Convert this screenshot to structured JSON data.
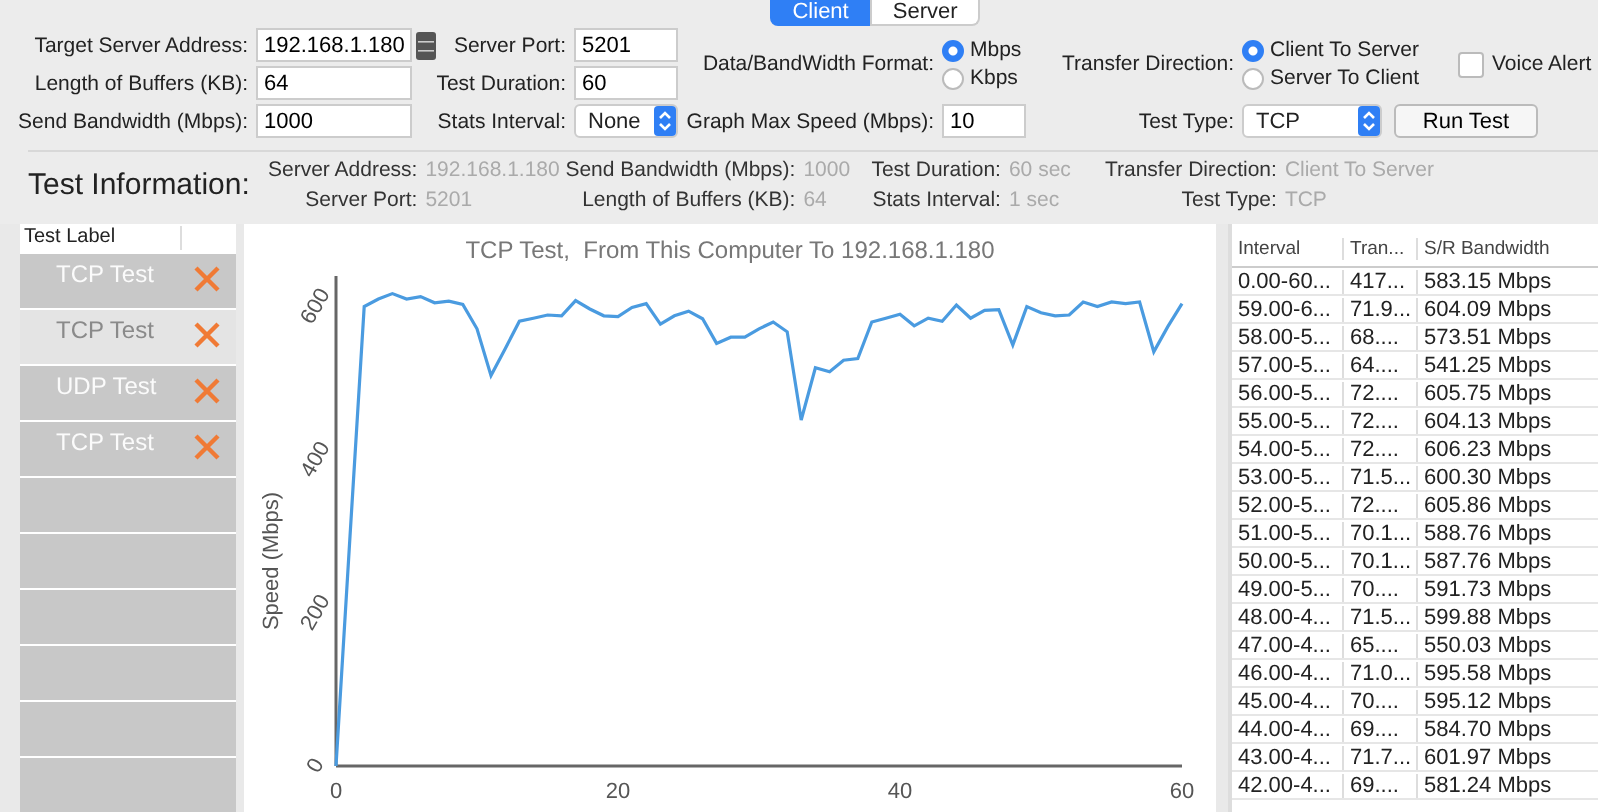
{
  "mode_tabs": [
    {
      "label": "Client",
      "selected": true
    },
    {
      "label": "Server",
      "selected": false
    }
  ],
  "form": {
    "target_server_address": {
      "label": "Target Server Address:",
      "value": "192.168.1.180"
    },
    "server_port": {
      "label": "Server Port:",
      "value": "5201"
    },
    "bandwidth_format": {
      "label": "Data/BandWidth Format:",
      "options": [
        {
          "label": "Mbps",
          "selected": true
        },
        {
          "label": "Kbps",
          "selected": false
        }
      ]
    },
    "transfer_direction": {
      "label": "Transfer Direction:",
      "options": [
        {
          "label": "Client To Server",
          "selected": true
        },
        {
          "label": "Server To Client",
          "selected": false
        }
      ]
    },
    "voice_alert": {
      "label": "Voice Alert",
      "checked": false
    },
    "length_of_buffers": {
      "label": "Length of Buffers (KB):",
      "value": "64"
    },
    "test_duration": {
      "label": "Test Duration:",
      "value": "60"
    },
    "send_bandwidth": {
      "label": "Send Bandwidth (Mbps):",
      "value": "1000"
    },
    "stats_interval": {
      "label": "Stats Interval:",
      "value": "None"
    },
    "graph_max_speed": {
      "label": "Graph Max Speed (Mbps):",
      "value": "10"
    },
    "test_type": {
      "label": "Test Type:",
      "value": "TCP"
    },
    "run_button": "Run Test"
  },
  "test_information": {
    "title": "Test Information:",
    "items": [
      {
        "label": "Server Address:",
        "value": "192.168.1.180"
      },
      {
        "label": "Send Bandwidth (Mbps):",
        "value": "1000"
      },
      {
        "label": "Test Duration:",
        "value": "60 sec"
      },
      {
        "label": "Transfer Direction:",
        "value": "Client To Server"
      },
      {
        "label": "Server Port:",
        "value": "5201"
      },
      {
        "label": "Length of Buffers (KB):",
        "value": "64"
      },
      {
        "label": "Stats Interval:",
        "value": "1 sec"
      },
      {
        "label": "Test Type:",
        "value": "TCP"
      }
    ]
  },
  "test_list": {
    "header": "Test Label",
    "items": [
      {
        "label": "TCP Test",
        "selected": false
      },
      {
        "label": "TCP Test",
        "selected": true
      },
      {
        "label": "UDP Test",
        "selected": false
      },
      {
        "label": "TCP Test",
        "selected": false
      }
    ]
  },
  "chart": {
    "chart_data": {
      "type": "line",
      "title": "TCP Test,  From This Computer To 192.168.1.180",
      "ylabel": "Speed (Mbps)",
      "x": [
        0,
        1,
        2,
        3,
        4,
        5,
        6,
        7,
        8,
        9,
        10,
        11,
        12,
        13,
        14,
        15,
        16,
        17,
        18,
        19,
        20,
        21,
        22,
        23,
        24,
        25,
        26,
        27,
        28,
        29,
        30,
        31,
        32,
        33,
        34,
        35,
        36,
        37,
        38,
        39,
        40,
        41,
        42,
        43,
        44,
        45,
        46,
        47,
        48,
        49,
        50,
        51,
        52,
        53,
        54,
        55,
        56,
        57,
        58,
        59,
        60
      ],
      "series": [
        {
          "color": "#4a9be0",
          "values": [
            0,
            300,
            600,
            610,
            617,
            610,
            613,
            605,
            607,
            603,
            571,
            510,
            545,
            581,
            585,
            589,
            588,
            608,
            597,
            588,
            587,
            599,
            604,
            577,
            588,
            594,
            584,
            552,
            560,
            560,
            571,
            580,
            567,
            452,
            520,
            515,
            530,
            532,
            580,
            585,
            590,
            575,
            585,
            581,
            602,
            585,
            595,
            596,
            550,
            600,
            592,
            588,
            589,
            606,
            600,
            606,
            604,
            606,
            541,
            574,
            604
          ]
        }
      ],
      "xlim": [
        0,
        60
      ],
      "ylim": [
        0,
        640
      ],
      "xticks": [
        0,
        20,
        40,
        60
      ],
      "yticks": [
        0,
        200,
        400,
        600
      ]
    }
  },
  "results_table": {
    "columns": [
      "Interval",
      "Tran...",
      "S/R Bandwidth"
    ],
    "rows": [
      [
        "0.00-60...",
        "417...",
        "583.15 Mbps"
      ],
      [
        "59.00-6...",
        "71.9...",
        "604.09 Mbps"
      ],
      [
        "58.00-5...",
        "68....",
        "573.51 Mbps"
      ],
      [
        "57.00-5...",
        "64....",
        "541.25 Mbps"
      ],
      [
        "56.00-5...",
        "72....",
        "605.75 Mbps"
      ],
      [
        "55.00-5...",
        "72....",
        "604.13 Mbps"
      ],
      [
        "54.00-5...",
        "72....",
        "606.23 Mbps"
      ],
      [
        "53.00-5...",
        "71.5...",
        "600.30 Mbps"
      ],
      [
        "52.00-5...",
        "72....",
        "605.86 Mbps"
      ],
      [
        "51.00-5...",
        "70.1...",
        "588.76 Mbps"
      ],
      [
        "50.00-5...",
        "70.1...",
        "587.76 Mbps"
      ],
      [
        "49.00-5...",
        "70....",
        "591.73 Mbps"
      ],
      [
        "48.00-4...",
        "71.5...",
        "599.88 Mbps"
      ],
      [
        "47.00-4...",
        "65....",
        "550.03 Mbps"
      ],
      [
        "46.00-4...",
        "71.0...",
        "595.58 Mbps"
      ],
      [
        "45.00-4...",
        "70....",
        "595.12 Mbps"
      ],
      [
        "44.00-4...",
        "69....",
        "584.70 Mbps"
      ],
      [
        "43.00-4...",
        "71.7...",
        "601.97 Mbps"
      ],
      [
        "42.00-4...",
        "69....",
        "581.24 Mbps"
      ]
    ]
  }
}
